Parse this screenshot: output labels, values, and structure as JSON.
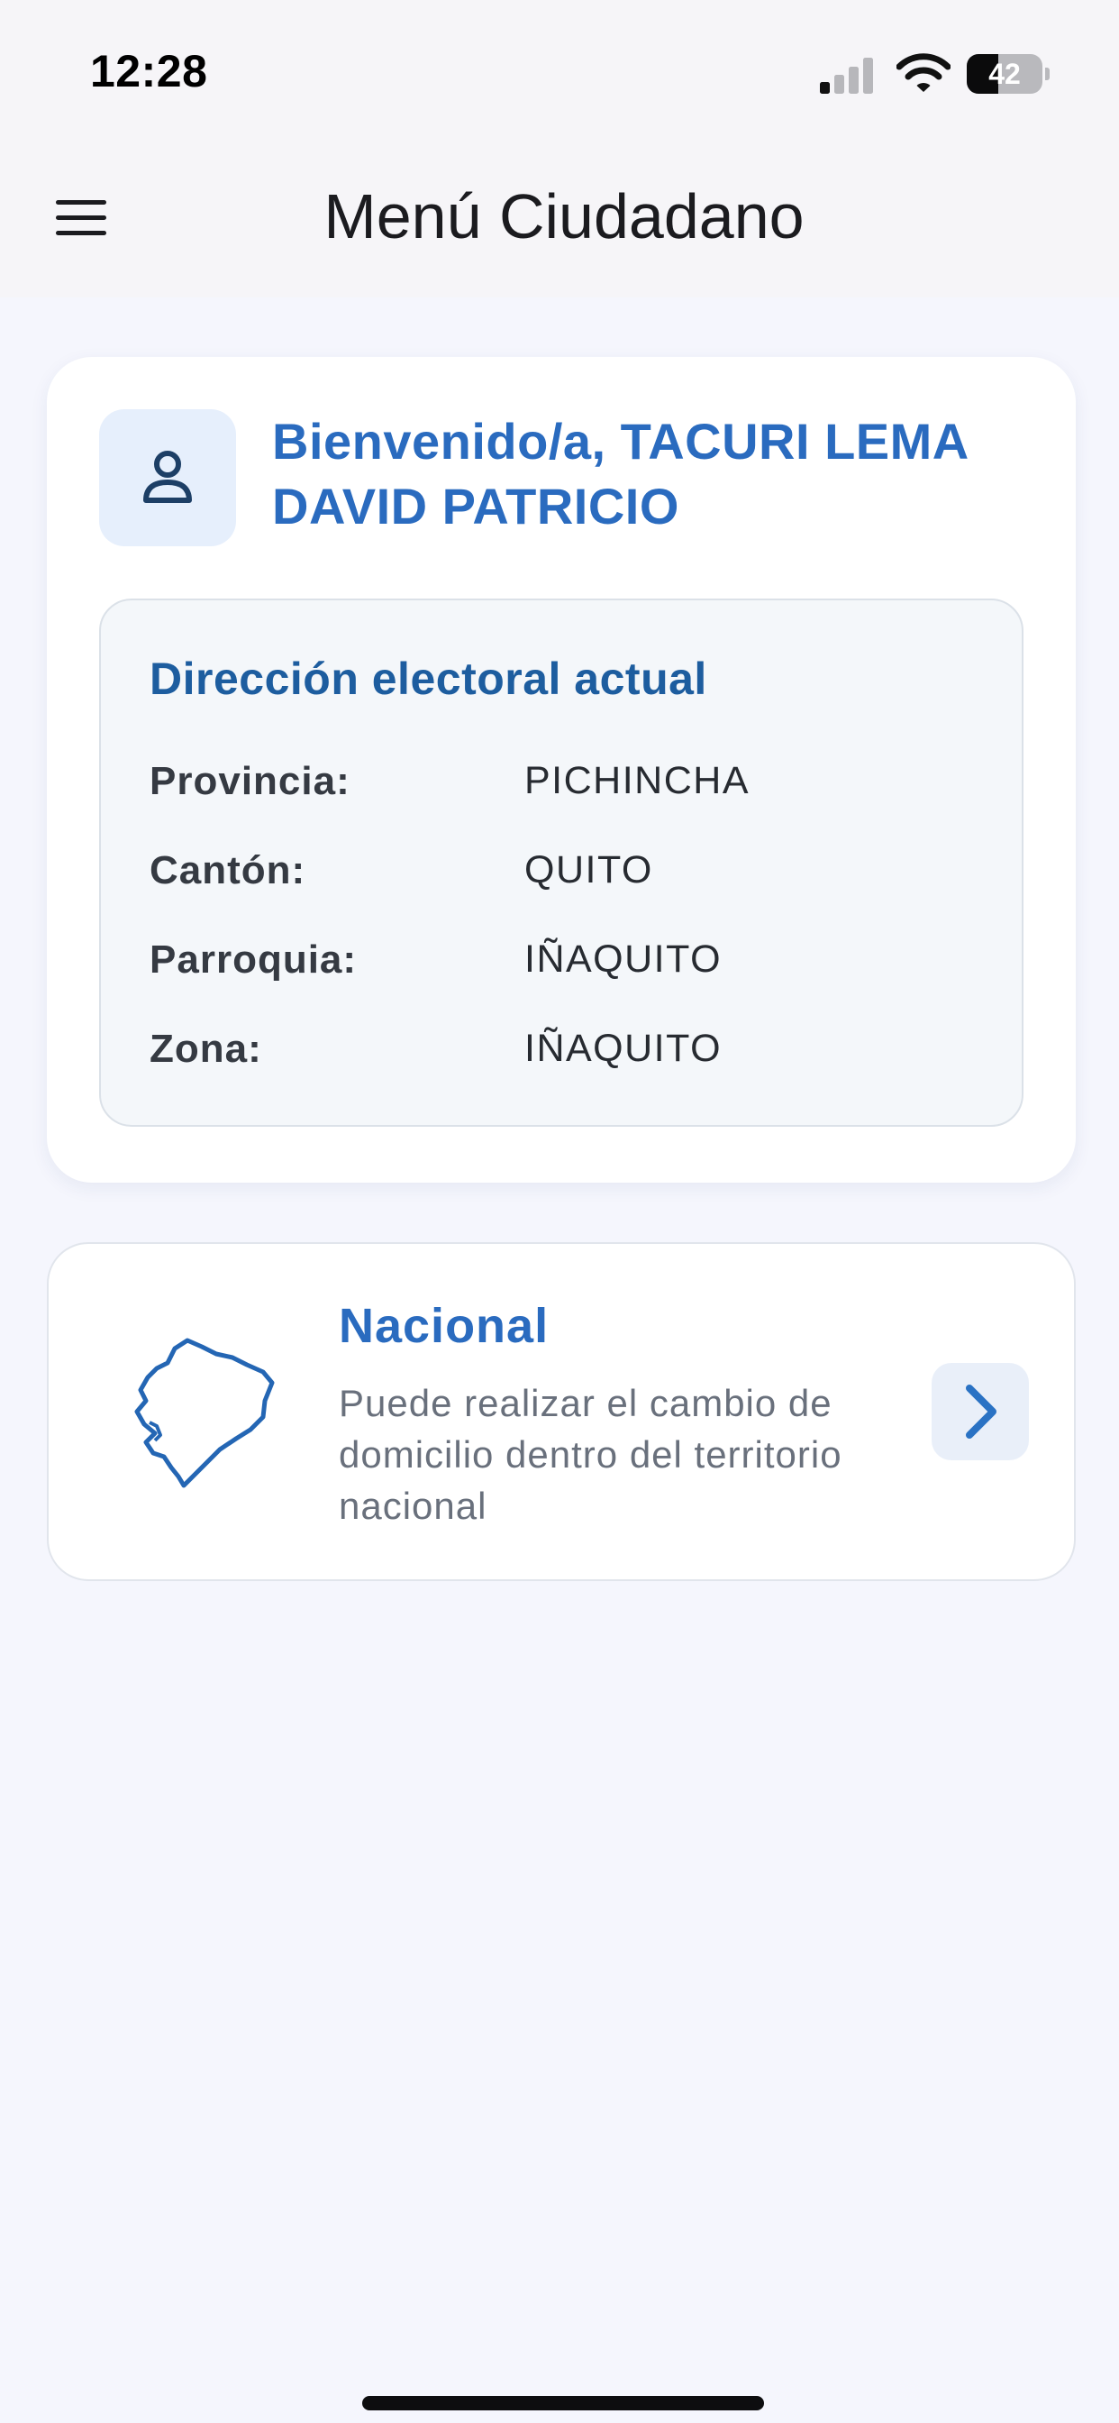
{
  "status_bar": {
    "time": "12:28",
    "battery_level": "42",
    "battery_fraction": 0.42,
    "icons": [
      "signal-icon",
      "wifi-icon",
      "battery-icon"
    ]
  },
  "app_bar": {
    "title": "Menú Ciudadano",
    "menu_icon": "hamburger-menu-icon"
  },
  "welcome": {
    "avatar_icon": "user-icon",
    "text": "Bienvenido/a, TACURI LEMA DAVID PATRICIO"
  },
  "address": {
    "title": "Dirección electoral actual",
    "rows": [
      {
        "label": "Provincia:",
        "value": "PICHINCHA"
      },
      {
        "label": "Cantón:",
        "value": "QUITO"
      },
      {
        "label": "Parroquia:",
        "value": "IÑAQUITO"
      },
      {
        "label": "Zona:",
        "value": "IÑAQUITO"
      }
    ]
  },
  "nacional": {
    "icon": "ecuador-map-icon",
    "title": "Nacional",
    "description": "Puede realizar el cambio de domicilio dentro del territorio nacional",
    "action_icon": "chevron-right-icon"
  },
  "colors": {
    "background": "#f5f6fd",
    "app_bar": "#f6f5f8",
    "accent": "#2a6bbf",
    "accent_dark": "#1d5d9f",
    "card": "#ffffff",
    "address_box": "#f4f7fa",
    "avatar_bg": "#e6effc"
  }
}
